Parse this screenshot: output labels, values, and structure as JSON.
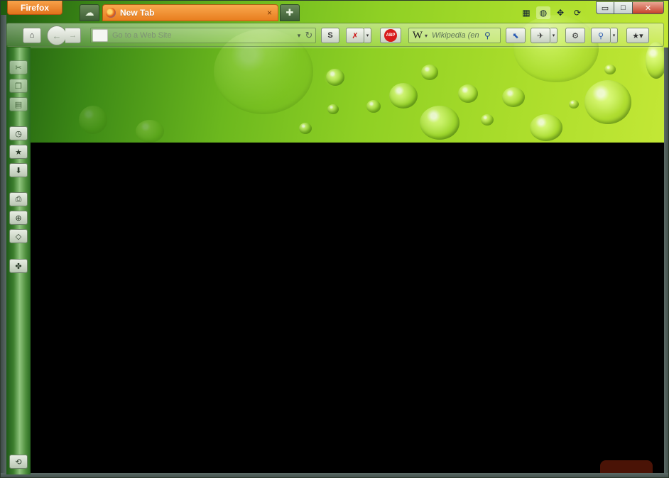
{
  "app": {
    "menu_button_label": "Firefox"
  },
  "tabs": [
    {
      "label": "New Tab",
      "active": true,
      "close": "×"
    }
  ],
  "window_controls": {
    "minimize": "▭",
    "maximize": "□",
    "close": "✕"
  },
  "toolbar": {
    "home_glyph": "⌂",
    "back_glyph": "←",
    "forward_glyph": "→",
    "url_placeholder": "Go to a Web Site",
    "url_drop_glyph": "▾",
    "reload_glyph": "↻",
    "search_engine_glyph": "W",
    "search_caret": "▾",
    "search_placeholder": "Wikipedia (en",
    "search_go_glyph": "⚲",
    "abp_label": "ABP",
    "s_label": "S"
  },
  "icons": {
    "tab_groups": "tab-groups-icon",
    "new_tab": "new-tab-icon",
    "apps": "apps-grid-icon",
    "globe": "globe-icon",
    "move": "move-icon",
    "sync": "sync-icon"
  },
  "colors": {
    "tab_orange": "#e87d1f",
    "menu_orange": "#e1721a",
    "header_green": "#8fd024",
    "sidebar_green": "#3d7f2e",
    "content_bg": "#000000"
  }
}
